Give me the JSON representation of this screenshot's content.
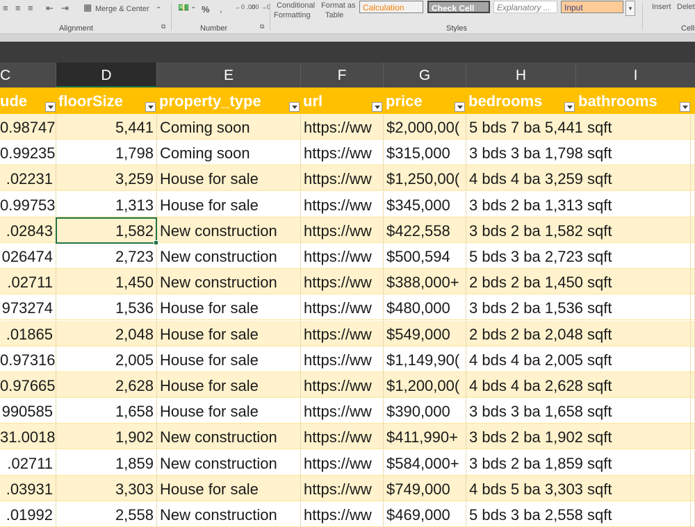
{
  "ribbon": {
    "merge_center": "Merge & Center",
    "alignment_label": "Alignment",
    "number_label": "Number",
    "percent": "%",
    "comma": ",",
    "dec_inc": "←0 .00",
    "dec_dec": ".00 →0",
    "conditional_formatting_1": "Conditional",
    "conditional_formatting_2": "Formatting",
    "format_as_table_1": "Format as",
    "format_as_table_2": "Table",
    "styles_label": "Styles",
    "style_calculation": "Calculation",
    "style_check_cell": "Check Cell",
    "style_explanatory": "Explanatory ...",
    "style_input": "Input",
    "insert": "Insert",
    "delete": "Delet",
    "cells_label": "Cells"
  },
  "columns": [
    "C",
    "D",
    "E",
    "F",
    "G",
    "H",
    "I"
  ],
  "selected_column": "D",
  "table_headers": [
    "ude",
    "floorSize",
    "property_type",
    "url",
    "price",
    "bedrooms",
    "bathrooms"
  ],
  "rows": [
    {
      "lon": "0.98747",
      "floor": "5,441",
      "type": "Coming soon",
      "url": "https://ww",
      "price": "$2,000,00(",
      "beds": "5 bds 7 ba 5,441 sqft"
    },
    {
      "lon": "0.99235",
      "floor": "1,798",
      "type": "Coming soon",
      "url": "https://ww",
      "price": "$315,000",
      "beds": "3 bds 3 ba 1,798 sqft"
    },
    {
      "lon": ".02231",
      "floor": "3,259",
      "type": "House for sale",
      "url": "https://ww",
      "price": "$1,250,00(",
      "beds": "4 bds 4 ba 3,259 sqft"
    },
    {
      "lon": "0.99753",
      "floor": "1,313",
      "type": "House for sale",
      "url": "https://ww",
      "price": "$345,000",
      "beds": "3 bds 2 ba 1,313 sqft"
    },
    {
      "lon": ".02843",
      "floor": "1,582",
      "type": "New construction",
      "url": "https://ww",
      "price": "$422,558",
      "beds": "3 bds 2 ba 1,582 sqft"
    },
    {
      "lon": "026474",
      "floor": "2,723",
      "type": "New construction",
      "url": "https://ww",
      "price": "$500,594",
      "beds": "5 bds 3 ba 2,723 sqft"
    },
    {
      "lon": ".02711",
      "floor": "1,450",
      "type": "New construction",
      "url": "https://ww",
      "price": "$388,000+",
      "beds": "2 bds 2 ba 1,450 sqft"
    },
    {
      "lon": "973274",
      "floor": "1,536",
      "type": "House for sale",
      "url": "https://ww",
      "price": "$480,000",
      "beds": "3 bds 2 ba 1,536 sqft"
    },
    {
      "lon": ".01865",
      "floor": "2,048",
      "type": "House for sale",
      "url": "https://ww",
      "price": "$549,000",
      "beds": "2 bds 2 ba 2,048 sqft"
    },
    {
      "lon": "0.97316",
      "floor": "2,005",
      "type": "House for sale",
      "url": "https://ww",
      "price": "$1,149,90(",
      "beds": "4 bds 4 ba 2,005 sqft"
    },
    {
      "lon": "0.97665",
      "floor": "2,628",
      "type": "House for sale",
      "url": "https://ww",
      "price": "$1,200,00(",
      "beds": "4 bds 4 ba 2,628 sqft"
    },
    {
      "lon": "990585",
      "floor": "1,658",
      "type": "House for sale",
      "url": "https://ww",
      "price": "$390,000",
      "beds": "3 bds 3 ba 1,658 sqft"
    },
    {
      "lon": "31.0018",
      "floor": "1,902",
      "type": "New construction",
      "url": "https://ww",
      "price": "$411,990+",
      "beds": "3 bds 2 ba 1,902 sqft"
    },
    {
      "lon": ".02711",
      "floor": "1,859",
      "type": "New construction",
      "url": "https://ww",
      "price": "$584,000+",
      "beds": "3 bds 2 ba 1,859 sqft"
    },
    {
      "lon": ".03931",
      "floor": "3,303",
      "type": "House for sale",
      "url": "https://ww",
      "price": "$749,000",
      "beds": "4 bds 5 ba 3,303 sqft"
    },
    {
      "lon": ".01992",
      "floor": "2,558",
      "type": "New construction",
      "url": "https://ww",
      "price": "$469,000",
      "beds": "5 bds 3 ba 2,558 sqft"
    }
  ],
  "colors": {
    "header_fill": "#ffc000",
    "band_fill": "#fff2cc",
    "selection": "#217346",
    "col_header_bg": "#4a4a4a"
  }
}
